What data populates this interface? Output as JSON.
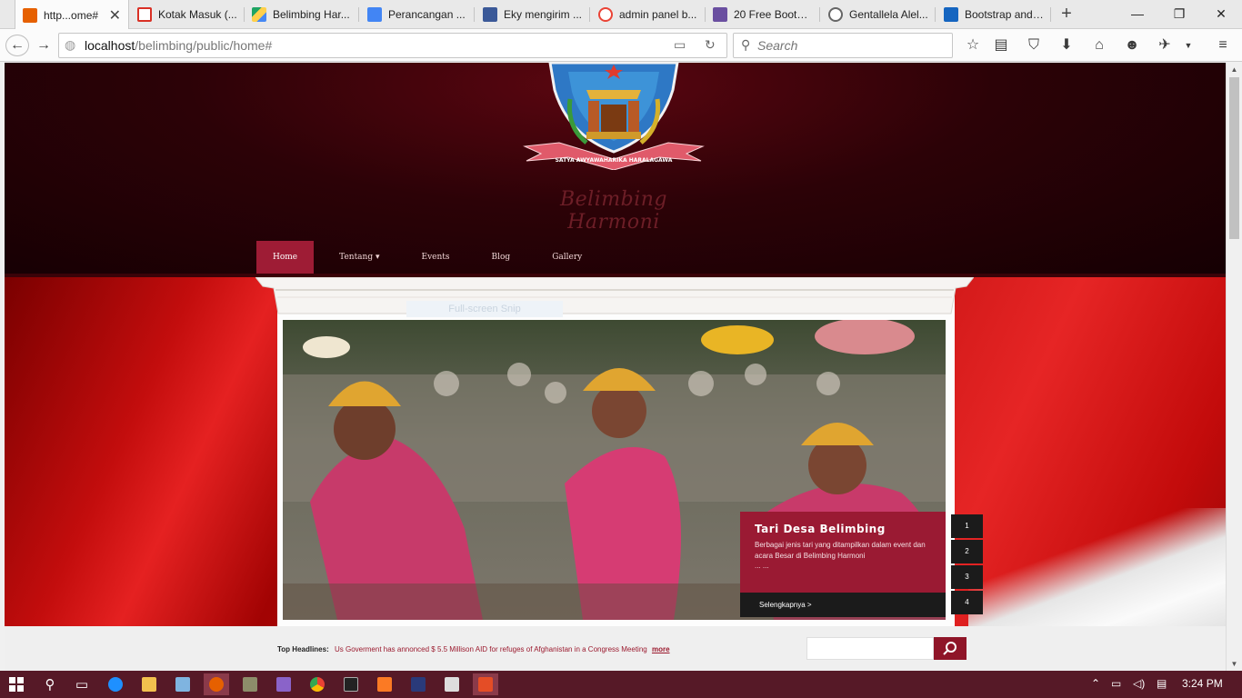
{
  "browser": {
    "tabs": [
      {
        "label": "http...ome#",
        "color": "#e66000",
        "active": true
      },
      {
        "label": "Kotak Masuk (...",
        "color": "#d93025"
      },
      {
        "label": "Belimbing Har...",
        "color": "#1fa463"
      },
      {
        "label": "Perancangan ...",
        "color": "#4285f4"
      },
      {
        "label": "Eky mengirim ...",
        "color": "#3b5998"
      },
      {
        "label": "admin panel b...",
        "color": "#ea4335"
      },
      {
        "label": "20 Free Bootst...",
        "color": "#6a4fa0"
      },
      {
        "label": "Gentallela Alel...",
        "color": "#666666"
      },
      {
        "label": "Bootstrap and ...",
        "color": "#1565c0"
      }
    ],
    "new_tab_label": "+",
    "window_controls": {
      "minimize": "—",
      "restore": "❐",
      "close": "✕"
    },
    "url_host": "localhost",
    "url_path": "/belimbing/public/home#",
    "search_placeholder": "Search"
  },
  "site": {
    "emblem_motto": "SATYA AWYAWAHARIKA HARALAGAWA",
    "brand_name": "Belimbing Harmoni",
    "menu": [
      {
        "label": "Home",
        "active": true
      },
      {
        "label": "Tentang ▾"
      },
      {
        "label": "Events"
      },
      {
        "label": "Blog"
      },
      {
        "label": "Gallery"
      }
    ],
    "ghost_text": "Full-screen Snip",
    "slider": {
      "title": "Tari Desa Belimbing",
      "description": "Berbagai jenis tari yang ditampilkan dalam event dan acara Besar di Belimbing Harmoni",
      "ellipsis": "... ...",
      "more_label": "Selengkapnya >",
      "pages": [
        "1",
        "2",
        "3",
        "4"
      ]
    },
    "ticker": {
      "label": "Top Headlines:",
      "message": "Us Goverment has annonced $ 5.5 Millison AID for refuges of Afghanistan in a Congress Meeting",
      "more_label": "more"
    }
  },
  "taskbar": {
    "apps": [
      {
        "name": "start",
        "color": "#ffffff"
      },
      {
        "name": "search",
        "color": "#ffffff"
      },
      {
        "name": "task-view",
        "color": "#ffffff"
      },
      {
        "name": "edge",
        "color": "#1e90ff"
      },
      {
        "name": "file-explorer",
        "color": "#f2c14e"
      },
      {
        "name": "network-tool",
        "color": "#7fb4e0"
      },
      {
        "name": "firefox",
        "color": "#e66000"
      },
      {
        "name": "app-dark",
        "color": "#8d8d6a"
      },
      {
        "name": "visual-studio",
        "color": "#8a63c9"
      },
      {
        "name": "chrome",
        "color": "#e6b33a"
      },
      {
        "name": "cmd",
        "color": "#222222"
      },
      {
        "name": "xampp",
        "color": "#fb7a24"
      },
      {
        "name": "photoshop",
        "color": "#2a3a7a"
      },
      {
        "name": "photos",
        "color": "#dddddd"
      },
      {
        "name": "calculator",
        "color": "#e44d26"
      }
    ],
    "time": "3:24 PM"
  }
}
